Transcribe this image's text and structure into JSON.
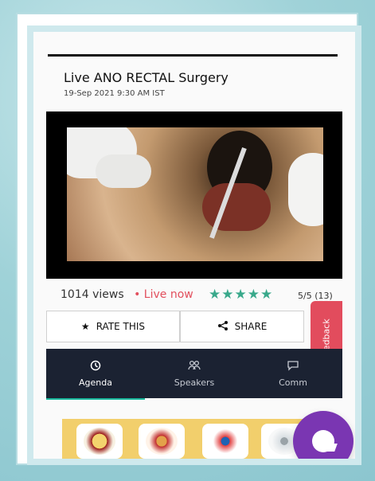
{
  "session": {
    "title": "Live ANO RECTAL Surgery",
    "datetime": "19-Sep 2021 9:30 AM IST"
  },
  "stats": {
    "views": "1014 views",
    "live_prefix": "•",
    "live_label": "Live now",
    "stars": "★★★★★",
    "rating": "5/5 (13)"
  },
  "actions": {
    "rate_icon": "★",
    "rate_label": "RATE THIS",
    "share_icon": "share-icon",
    "share_label": "SHARE"
  },
  "feedback": {
    "label": "Feedback"
  },
  "tabs": [
    {
      "label": "Agenda",
      "icon": "clock-icon",
      "active": true
    },
    {
      "label": "Speakers",
      "icon": "users-icon",
      "active": false
    },
    {
      "label": "Comm",
      "icon": "chat-icon",
      "active": false
    }
  ],
  "colors": {
    "accent": "#39a98b",
    "live": "#e24f5d",
    "feedback": "#e24c5d",
    "tabbar": "#1b2232",
    "chat": "#7a36b2",
    "logo_strip": "#f2cf6c"
  }
}
